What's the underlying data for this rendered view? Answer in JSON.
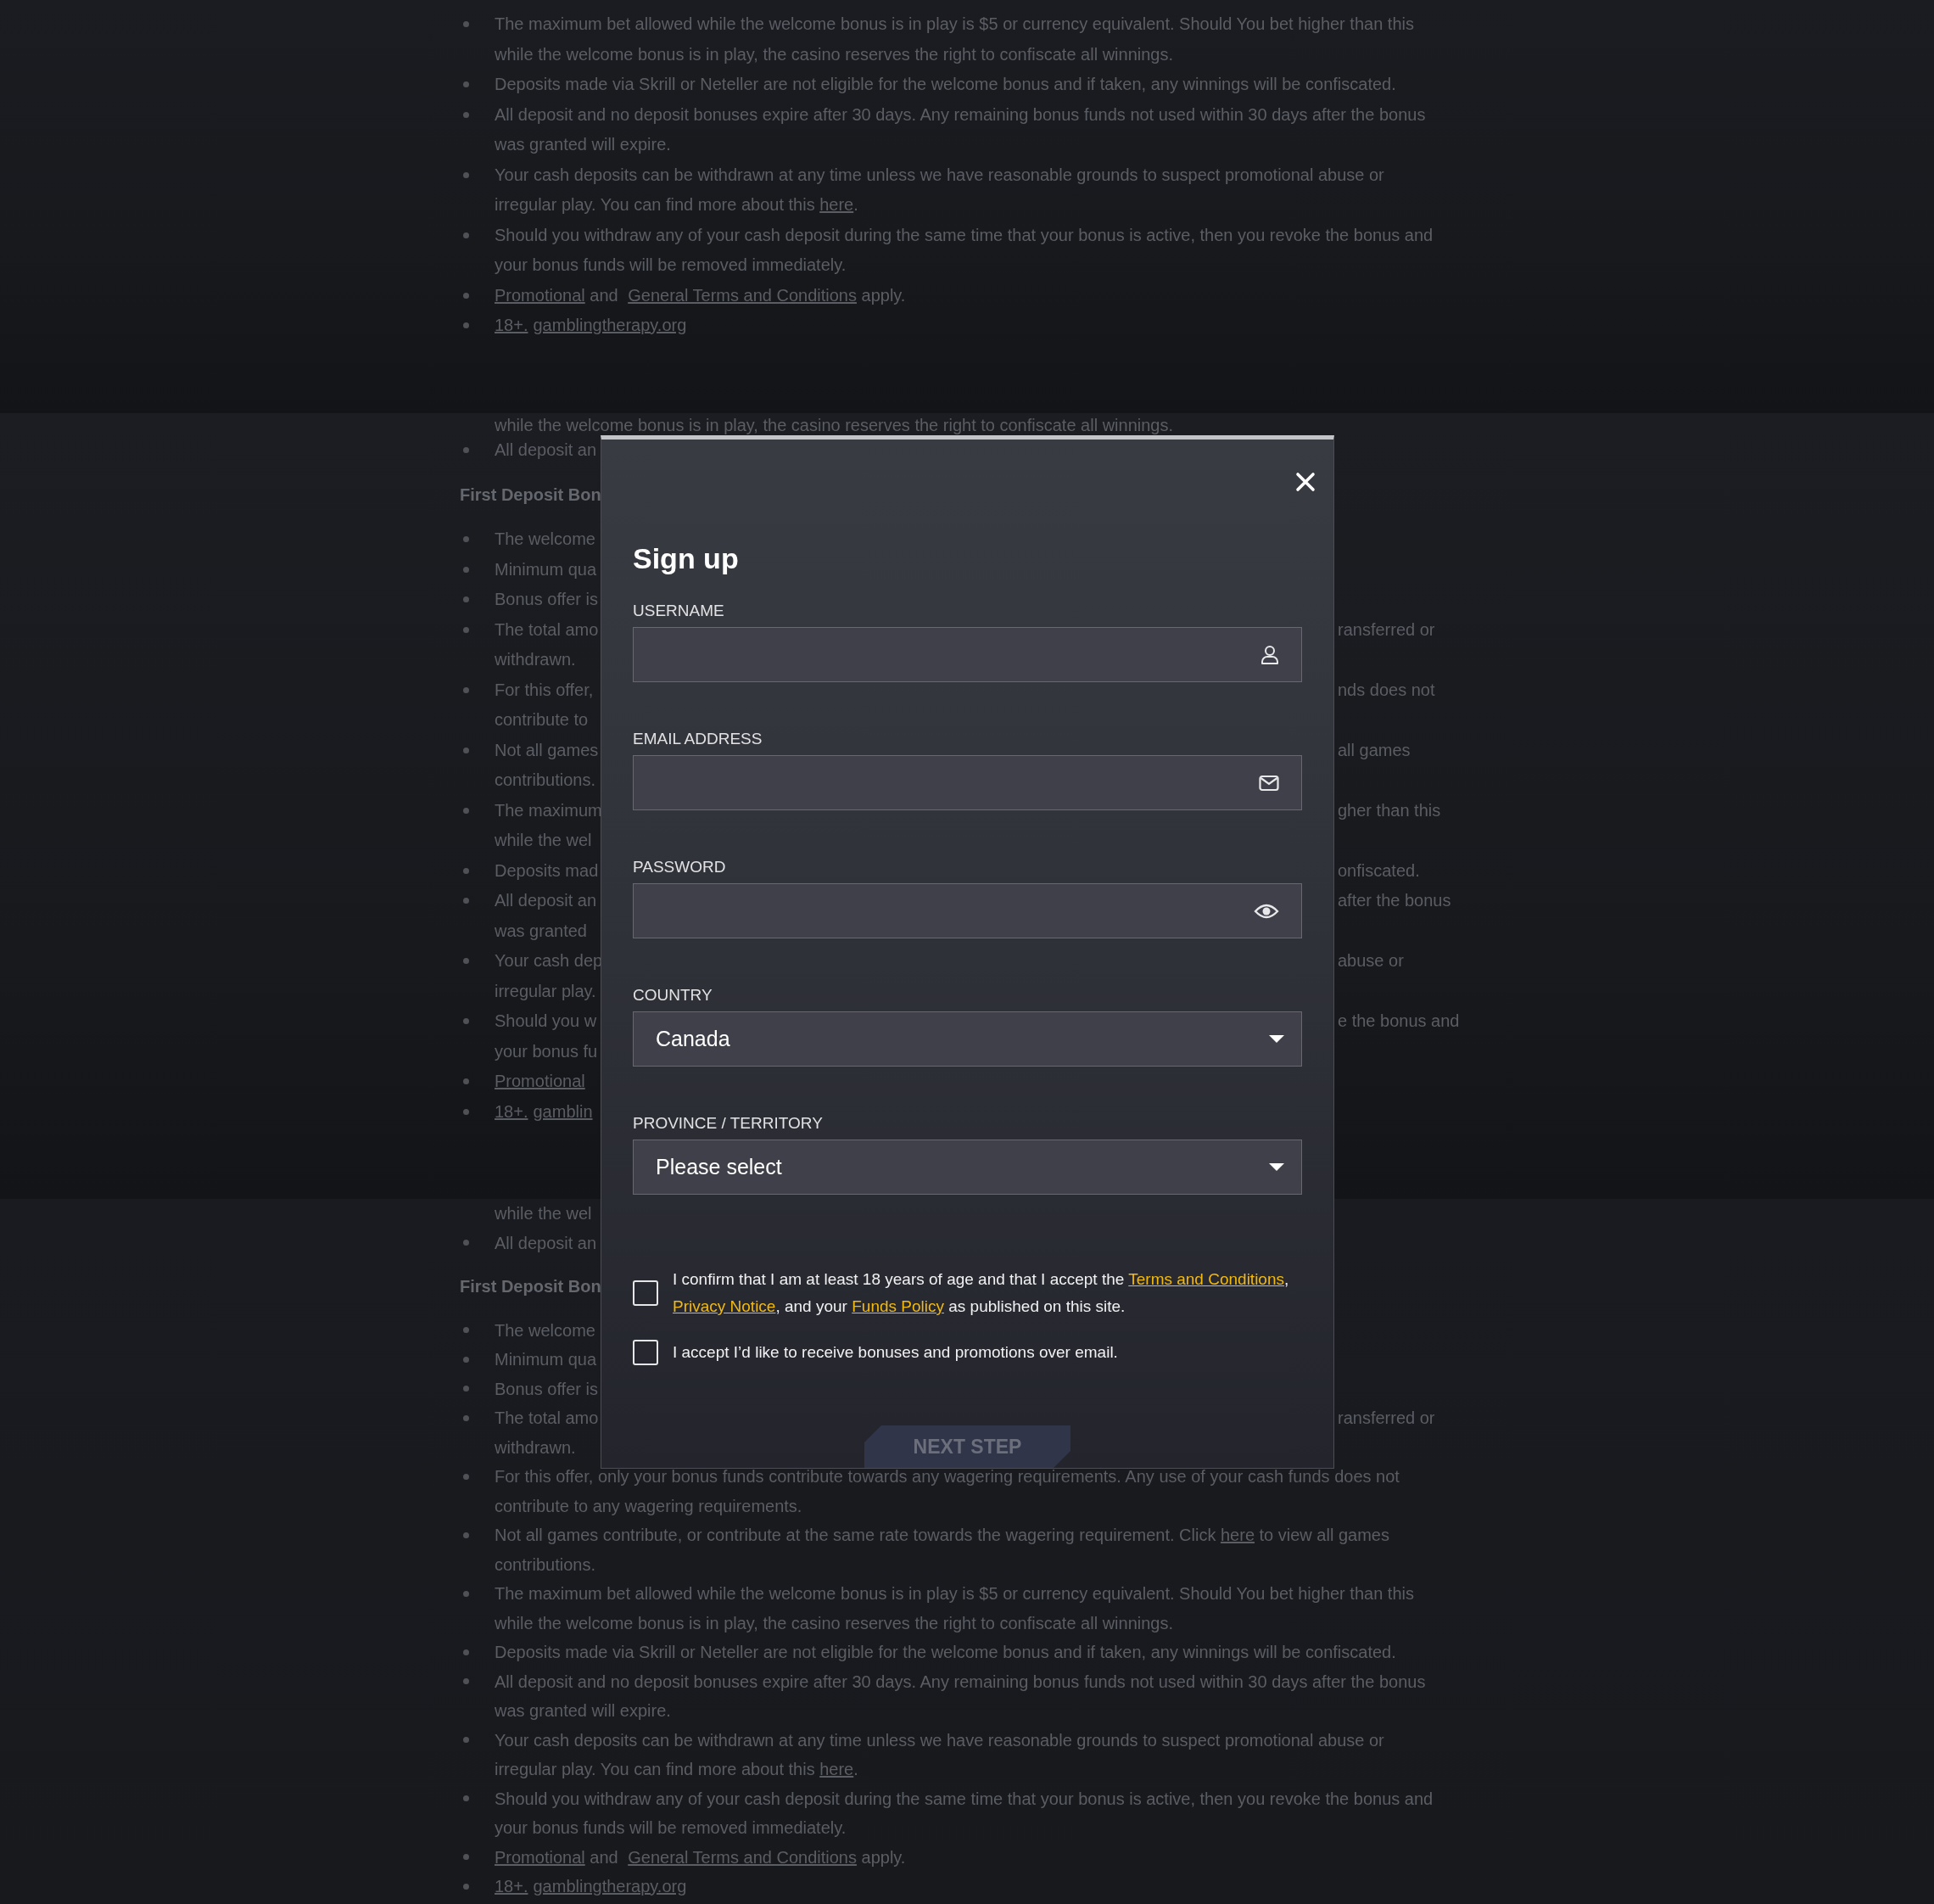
{
  "background": {
    "bands": [
      {
        "rows": [
          {
            "kind": "bullet",
            "text": "The maximum bet allowed while the welcome bonus is in play is $5 or currency equivalent. Should You bet higher than this"
          },
          {
            "kind": "wrap",
            "text": "while the welcome bonus is in play, the casino reserves the right to confiscate all winnings."
          },
          {
            "kind": "bullet",
            "text": "Deposits made via Skrill or Neteller are not eligible for the welcome bonus and if taken, any winnings will be confiscated."
          },
          {
            "kind": "bullet",
            "text": "All deposit and no deposit bonuses expire after 30 days. Any remaining bonus funds not used within 30 days after the bonus"
          },
          {
            "kind": "wrap",
            "text": "was granted will expire."
          },
          {
            "kind": "bullet",
            "text": "Your cash deposits can be withdrawn at any time unless we have reasonable grounds to suspect promotional abuse or"
          },
          {
            "kind": "wrap",
            "text": [
              {
                "kind": "text",
                "text": "irregular play. You can find more about this "
              },
              {
                "kind": "link",
                "text": "here"
              },
              {
                "kind": "text",
                "text": "."
              }
            ]
          },
          {
            "kind": "bullet",
            "text": "Should you withdraw any of your cash deposit during the same time that your bonus is active, then you revoke the bonus and"
          },
          {
            "kind": "wrap",
            "text": "your bonus funds will be removed immediately."
          },
          {
            "kind": "bullet",
            "text": [
              {
                "kind": "link",
                "text": "Promotional"
              },
              {
                "kind": "text",
                "text": " and "
              },
              {
                "kind": "link",
                "text": "General Terms and Conditions"
              },
              {
                "kind": "text",
                "text": " apply."
              }
            ]
          },
          {
            "kind": "bullet",
            "text": [
              {
                "kind": "link",
                "text": "18+."
              },
              {
                "kind": "link",
                "text": "gamblingtherapy.org"
              }
            ]
          }
        ]
      },
      {
        "rows": [
          {
            "kind": "wrap",
            "text": "while the welcome bonus is in play, the casino reserves the right to confiscate all winnings."
          },
          {
            "kind": "bullet",
            "left": "All deposit an"
          },
          {
            "kind": "heading",
            "left": "First Deposit Bon"
          },
          {
            "kind": "bullet",
            "left": "The welcome"
          },
          {
            "kind": "bullet",
            "left": "Minimum qua"
          },
          {
            "kind": "bullet",
            "left": "Bonus offer is"
          },
          {
            "kind": "bullet",
            "left": "The total amo",
            "right": "ransferred or"
          },
          {
            "kind": "wrap",
            "left": "withdrawn."
          },
          {
            "kind": "bullet",
            "left": "For this offer,",
            "right": "nds does not"
          },
          {
            "kind": "wrap",
            "left": "contribute to"
          },
          {
            "kind": "bullet",
            "left": "Not all games",
            "right": "all games"
          },
          {
            "kind": "wrap",
            "left": "contributions."
          },
          {
            "kind": "bullet",
            "left": "The maximum",
            "right": "gher than this"
          },
          {
            "kind": "wrap",
            "left": "while the wel"
          },
          {
            "kind": "bullet",
            "left": "Deposits mad",
            "right": "onfiscated."
          },
          {
            "kind": "bullet",
            "left": "All deposit an",
            "right": "after the bonus"
          },
          {
            "kind": "wrap",
            "left": "was granted"
          },
          {
            "kind": "bullet",
            "left": "Your cash dep",
            "right": "abuse or"
          },
          {
            "kind": "wrap",
            "left": "irregular play."
          },
          {
            "kind": "bullet",
            "left": "Should you w",
            "right": "e the bonus and"
          },
          {
            "kind": "wrap",
            "left": "your bonus fu"
          },
          {
            "kind": "bullet",
            "left": [
              {
                "kind": "link",
                "text": "Promotional"
              }
            ]
          },
          {
            "kind": "bullet",
            "left": [
              {
                "kind": "link",
                "text": "18+."
              },
              {
                "kind": "link",
                "text": "gamblin"
              }
            ]
          }
        ]
      },
      {
        "rows": [
          {
            "kind": "wrap",
            "left": "while the wel"
          },
          {
            "kind": "bullet",
            "left": "All deposit an"
          },
          {
            "kind": "heading",
            "left": "First Deposit Bon"
          },
          {
            "kind": "bullet",
            "left": "The welcome"
          },
          {
            "kind": "bullet",
            "left": "Minimum qua"
          },
          {
            "kind": "bullet",
            "left": "Bonus offer is"
          },
          {
            "kind": "bullet",
            "left": "The total amo",
            "right": "ransferred or"
          },
          {
            "kind": "wrap",
            "left": "withdrawn."
          },
          {
            "kind": "bullet",
            "text": "For this offer, only your bonus funds contribute towards any wagering requirements. Any use of your cash funds does not"
          },
          {
            "kind": "wrap",
            "text": "contribute to any wagering requirements."
          },
          {
            "kind": "bullet",
            "text": [
              {
                "kind": "text",
                "text": "Not all games contribute, or contribute at the same rate towards the wagering requirement. Click "
              },
              {
                "kind": "link",
                "text": "here"
              },
              {
                "kind": "text",
                "text": " to view all games"
              }
            ]
          },
          {
            "kind": "wrap",
            "text": "contributions."
          },
          {
            "kind": "bullet",
            "text": "The maximum bet allowed while the welcome bonus is in play is $5 or currency equivalent. Should You bet higher than this"
          },
          {
            "kind": "wrap",
            "text": "while the welcome bonus is in play, the casino reserves the right to confiscate all winnings."
          },
          {
            "kind": "bullet",
            "text": "Deposits made via Skrill or Neteller are not eligible for the welcome bonus and if taken, any winnings will be confiscated."
          },
          {
            "kind": "bullet",
            "text": "All deposit and no deposit bonuses expire after 30 days. Any remaining bonus funds not used within 30 days after the bonus"
          },
          {
            "kind": "wrap",
            "text": "was granted will expire."
          },
          {
            "kind": "bullet",
            "text": "Your cash deposits can be withdrawn at any time unless we have reasonable grounds to suspect promotional abuse or"
          },
          {
            "kind": "wrap",
            "text": [
              {
                "kind": "text",
                "text": "irregular play. You can find more about this "
              },
              {
                "kind": "link",
                "text": "here"
              },
              {
                "kind": "text",
                "text": "."
              }
            ]
          },
          {
            "kind": "bullet",
            "text": "Should you withdraw any of your cash deposit during the same time that your bonus is active, then you revoke the bonus and"
          },
          {
            "kind": "wrap",
            "text": "your bonus funds will be removed immediately."
          },
          {
            "kind": "bullet",
            "text": [
              {
                "kind": "link",
                "text": "Promotional"
              },
              {
                "kind": "text",
                "text": " and "
              },
              {
                "kind": "link",
                "text": "General Terms and Conditions"
              },
              {
                "kind": "text",
                "text": " apply."
              }
            ]
          },
          {
            "kind": "bullet",
            "text": [
              {
                "kind": "link",
                "text": "18+."
              },
              {
                "kind": "link",
                "text": "gamblingtherapy.org"
              }
            ]
          }
        ]
      }
    ]
  },
  "modal": {
    "title": "Sign up",
    "fields": [
      {
        "kind": "username",
        "label": "USERNAME"
      },
      {
        "kind": "email",
        "label": "EMAIL ADDRESS"
      },
      {
        "kind": "password",
        "label": "PASSWORD"
      },
      {
        "kind": "select",
        "label": "COUNTRY",
        "value": "Canada"
      },
      {
        "kind": "select",
        "label": "PROVINCE / TERRITORY",
        "value": "Please select"
      }
    ],
    "agreements": [
      {
        "checked": false,
        "text": [
          {
            "kind": "text",
            "text": "I confirm that I am at least 18 years of age and that I accept the "
          },
          {
            "kind": "link",
            "text": "Terms and Conditions"
          },
          {
            "kind": "text",
            "text": ", "
          },
          {
            "kind": "link",
            "text": "Privacy Notice"
          },
          {
            "kind": "text",
            "text": ", and your "
          },
          {
            "kind": "link",
            "text": "Funds Policy"
          },
          {
            "kind": "text",
            "text": " as published on this site."
          }
        ]
      },
      {
        "checked": false,
        "text": [
          {
            "kind": "text",
            "text": "I accept I’d like to receive bonuses and promotions over email."
          }
        ]
      }
    ],
    "next_button": {
      "label": "NEXT STEP",
      "disabled": true
    }
  }
}
